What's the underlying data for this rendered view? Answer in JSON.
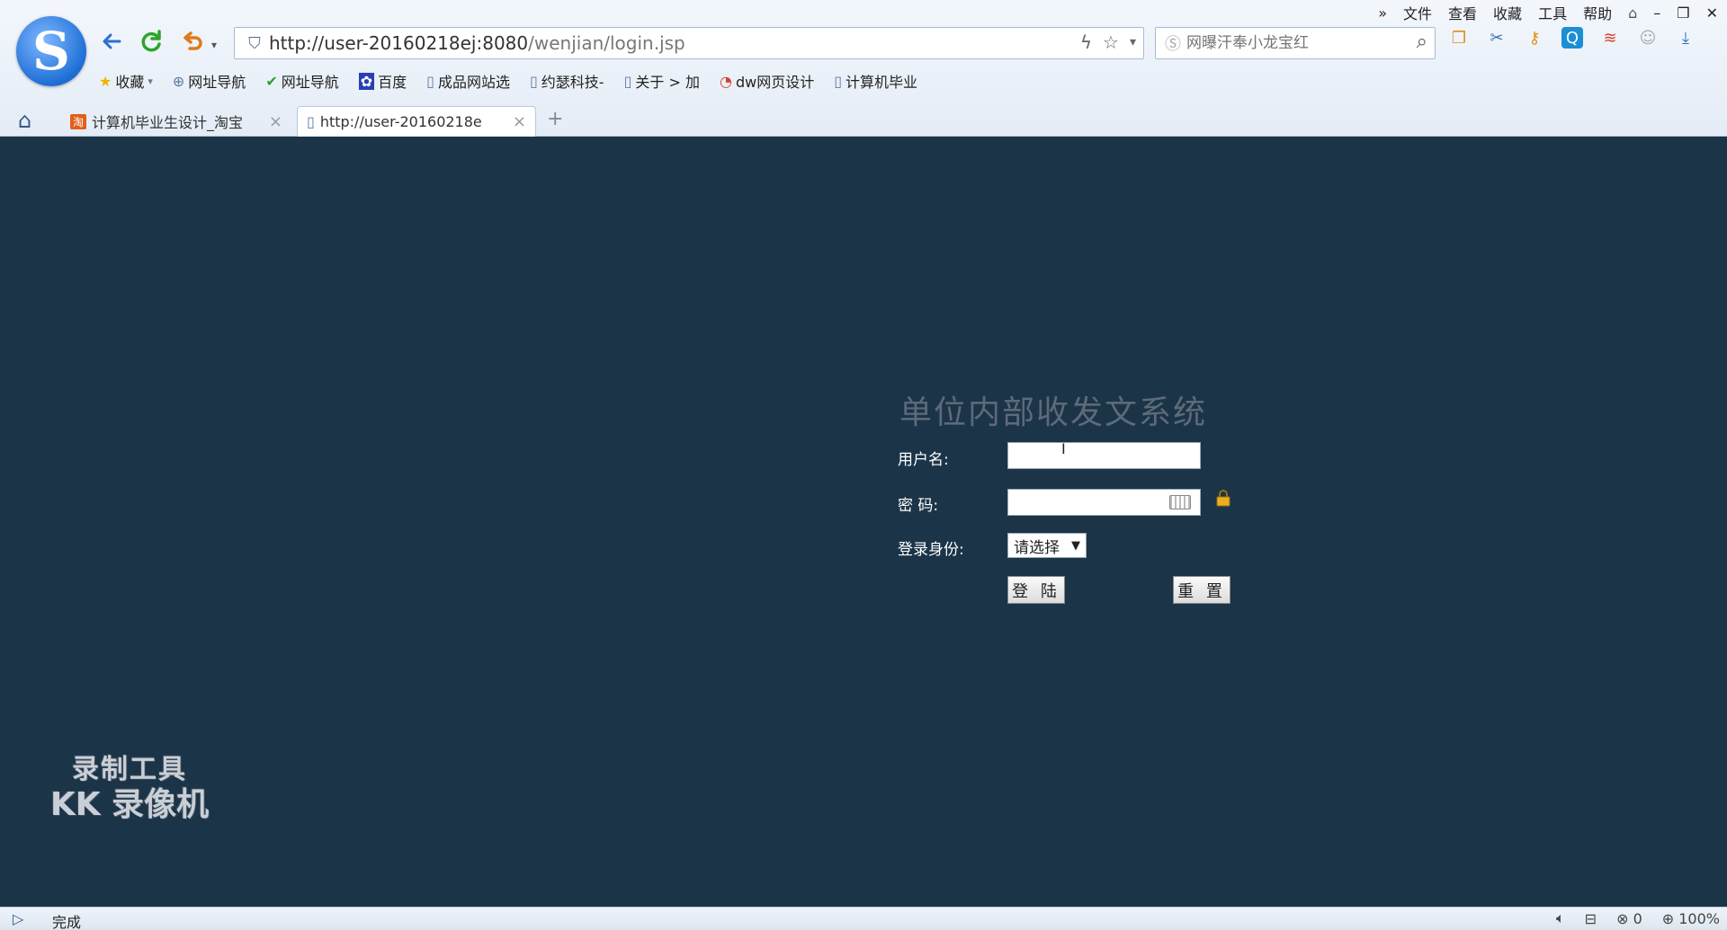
{
  "browser": {
    "menu": [
      "文件",
      "查看",
      "收藏",
      "工具",
      "帮助"
    ],
    "menu_more": "»",
    "address": {
      "host": "http://user-20160218ej:8080",
      "path": "/wenjian/login.jsp"
    },
    "search_placeholder": "网曝汗奉小龙宝红",
    "bookmarks": [
      "收藏",
      "网址导航",
      "网址导航",
      "百度",
      "成品网站选",
      "约瑟科技-",
      "关于 > 加",
      "dw网页设计",
      "计算机毕业"
    ],
    "tabs": [
      {
        "label": "计算机毕业生设计_淘宝",
        "active": false
      },
      {
        "label": "http://user-20160218e",
        "active": true
      }
    ],
    "new_tab": "+"
  },
  "login": {
    "title": "单位内部收发文系统",
    "username_label": "用户名:",
    "username_value": "",
    "password_label": "密 码:",
    "password_value": "",
    "role_label": "登录身份:",
    "role_selected": "请选择",
    "login_button": "登 陆",
    "reset_button": "重 置"
  },
  "watermark": {
    "line1": "录制工具",
    "line2": "KK 录像机"
  },
  "status": {
    "text": "完成",
    "counter": "0",
    "zoom": "100%"
  },
  "colors": {
    "page_bg": "#1b3448",
    "title": "#5d6a7a"
  }
}
